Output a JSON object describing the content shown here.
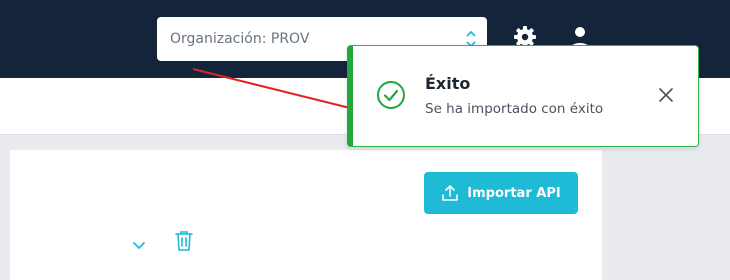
{
  "header": {
    "organization_select": {
      "value": "Organización: PROV"
    },
    "icons": [
      "settings-icon",
      "user-icon"
    ]
  },
  "card": {
    "import_button_label": "Importar API",
    "icons": [
      "upload-icon",
      "chevron-down-icon",
      "trash-icon"
    ]
  },
  "toast": {
    "title": "Éxito",
    "message": "Se ha importado con éxito",
    "icons": [
      "check-circle-icon",
      "close-icon"
    ]
  },
  "colors": {
    "topbar": "#13243b",
    "accent": "#1fbad6",
    "success": "#21a83a",
    "annotation_arrow": "#e02424"
  }
}
